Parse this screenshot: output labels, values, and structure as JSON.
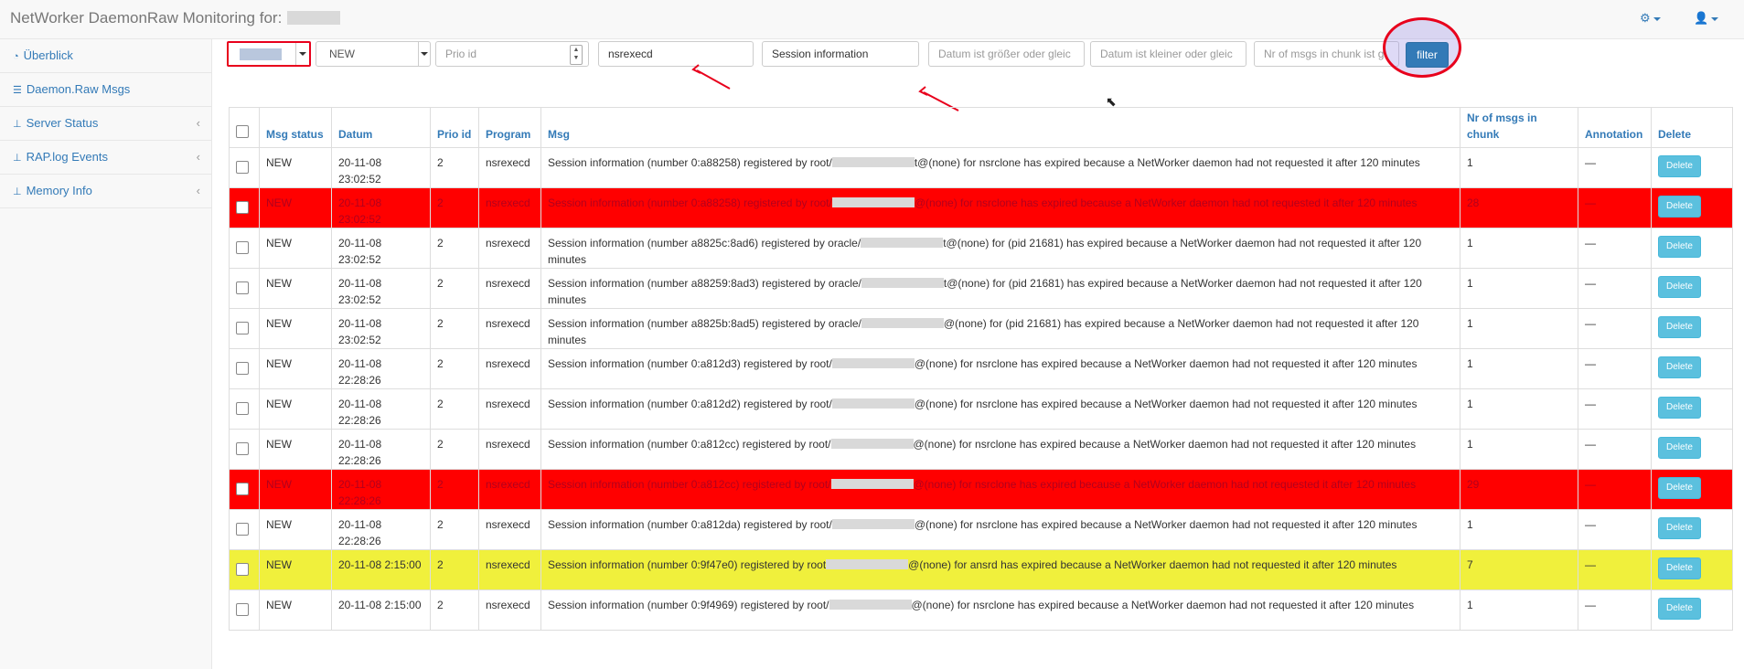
{
  "navbar": {
    "title": "NetWorker DaemonRaw Monitoring for:",
    "settings_icon": "cogs-icon",
    "user_icon": "user-icon"
  },
  "sidebar": {
    "items": [
      {
        "label": "Überblick",
        "icon": "dashboard-icon",
        "has_chevron": false
      },
      {
        "label": "Daemon.Raw Msgs",
        "icon": "list-icon",
        "has_chevron": false
      },
      {
        "label": "Server Status",
        "icon": "sitemap-icon",
        "has_chevron": true
      },
      {
        "label": "RAP.log Events",
        "icon": "sitemap-icon",
        "has_chevron": true
      },
      {
        "label": "Memory Info",
        "icon": "sitemap-icon",
        "has_chevron": true
      }
    ]
  },
  "filters": {
    "status_value": "NEW",
    "prio_placeholder": "Prio id",
    "program_value": "nsrexecd",
    "msg_value": "Session information",
    "date_gt_placeholder": "Datum ist größer oder gleic",
    "date_lt_placeholder": "Datum ist kleiner oder gleic",
    "nr_placeholder": "Nr of msgs in chunk ist g",
    "filter_label": "filter"
  },
  "table": {
    "headers": {
      "status": "Msg status",
      "datum": "Datum",
      "prio": "Prio id",
      "program": "Program",
      "msg": "Msg",
      "nr": "Nr of msgs in chunk",
      "annotation": "Annotation",
      "delete": "Delete"
    },
    "rows": [
      {
        "status": "NEW",
        "datum": "20-11-08 23:02:52",
        "prio": "2",
        "program": "nsrexecd",
        "msg_a": "Session information (number 0:a88258) registered by root/",
        "msg_b": "t@(none) for nsrclone has expired because a NetWorker daemon had not requested it after 120 minutes",
        "nr": "1",
        "annotation": "—",
        "delete": "Delete",
        "highlight": ""
      },
      {
        "status": "NEW",
        "datum": "20-11-08 23:02:52",
        "prio": "2",
        "program": "nsrexecd",
        "msg_a": "Session information (number 0:a88258) registered by root/",
        "msg_b": "@(none) for nsrclone has expired because a NetWorker daemon had not requested it after 120 minutes",
        "nr": "28",
        "annotation": "—",
        "delete": "Delete",
        "highlight": "red"
      },
      {
        "status": "NEW",
        "datum": "20-11-08 23:02:52",
        "prio": "2",
        "program": "nsrexecd",
        "msg_a": "Session information (number a8825c:8ad6) registered by oracle/",
        "msg_b": "t@(none) for (pid 21681) has expired because a NetWorker daemon had not requested it after 120 minutes",
        "nr": "1",
        "annotation": "—",
        "delete": "Delete",
        "highlight": ""
      },
      {
        "status": "NEW",
        "datum": "20-11-08 23:02:52",
        "prio": "2",
        "program": "nsrexecd",
        "msg_a": "Session information (number a88259:8ad3) registered by oracle/",
        "msg_b": "t@(none) for (pid 21681) has expired because a NetWorker daemon had not requested it after 120 minutes",
        "nr": "1",
        "annotation": "—",
        "delete": "Delete",
        "highlight": ""
      },
      {
        "status": "NEW",
        "datum": "20-11-08 23:02:52",
        "prio": "2",
        "program": "nsrexecd",
        "msg_a": "Session information (number a8825b:8ad5) registered by oracle/",
        "msg_b": "@(none) for (pid 21681) has expired because a NetWorker daemon had not requested it after 120 minutes",
        "nr": "1",
        "annotation": "—",
        "delete": "Delete",
        "highlight": ""
      },
      {
        "status": "NEW",
        "datum": "20-11-08 22:28:26",
        "prio": "2",
        "program": "nsrexecd",
        "msg_a": "Session information (number 0:a812d3) registered by root/",
        "msg_b": "@(none) for nsrclone has expired because a NetWorker daemon had not requested it after 120 minutes",
        "nr": "1",
        "annotation": "—",
        "delete": "Delete",
        "highlight": ""
      },
      {
        "status": "NEW",
        "datum": "20-11-08 22:28:26",
        "prio": "2",
        "program": "nsrexecd",
        "msg_a": "Session information (number 0:a812d2) registered by root/",
        "msg_b": "@(none) for nsrclone has expired because a NetWorker daemon had not requested it after 120 minutes",
        "nr": "1",
        "annotation": "—",
        "delete": "Delete",
        "highlight": ""
      },
      {
        "status": "NEW",
        "datum": "20-11-08 22:28:26",
        "prio": "2",
        "program": "nsrexecd",
        "msg_a": "Session information (number 0:a812cc) registered by root/",
        "msg_b": "@(none) for nsrclone has expired because a NetWorker daemon had not requested it after 120 minutes",
        "nr": "1",
        "annotation": "—",
        "delete": "Delete",
        "highlight": ""
      },
      {
        "status": "NEW",
        "datum": "20-11-08 22:28:26",
        "prio": "2",
        "program": "nsrexecd",
        "msg_a": "Session information (number 0:a812cc) registered by root/",
        "msg_b": "@(none) for nsrclone has expired because a NetWorker daemon had not requested it after 120 minutes",
        "nr": "29",
        "annotation": "—",
        "delete": "Delete",
        "highlight": "red"
      },
      {
        "status": "NEW",
        "datum": "20-11-08 22:28:26",
        "prio": "2",
        "program": "nsrexecd",
        "msg_a": "Session information (number 0:a812da) registered by root/",
        "msg_b": "@(none) for nsrclone has expired because a NetWorker daemon had not requested it after 120 minutes",
        "nr": "1",
        "annotation": "—",
        "delete": "Delete",
        "highlight": ""
      },
      {
        "status": "NEW",
        "datum": "20-11-08 2:15:00",
        "prio": "2",
        "program": "nsrexecd",
        "msg_a": "Session information (number 0:9f47e0) registered by root",
        "msg_b": "@(none) for ansrd has expired because a NetWorker daemon had not requested it after 120 minutes",
        "nr": "7",
        "annotation": "—",
        "delete": "Delete",
        "highlight": "yellow"
      },
      {
        "status": "NEW",
        "datum": "20-11-08 2:15:00",
        "prio": "2",
        "program": "nsrexecd",
        "msg_a": "Session information (number 0:9f4969) registered by root/",
        "msg_b": "@(none) for nsrclone has expired because a NetWorker daemon had not requested it after 120 minutes",
        "nr": "1",
        "annotation": "—",
        "delete": "Delete",
        "highlight": ""
      }
    ]
  },
  "colors": {
    "accent": "#337ab7",
    "highlight_red": "#ff0000",
    "highlight_yellow": "#f0f03c",
    "annotation_red": "#e8001c"
  }
}
